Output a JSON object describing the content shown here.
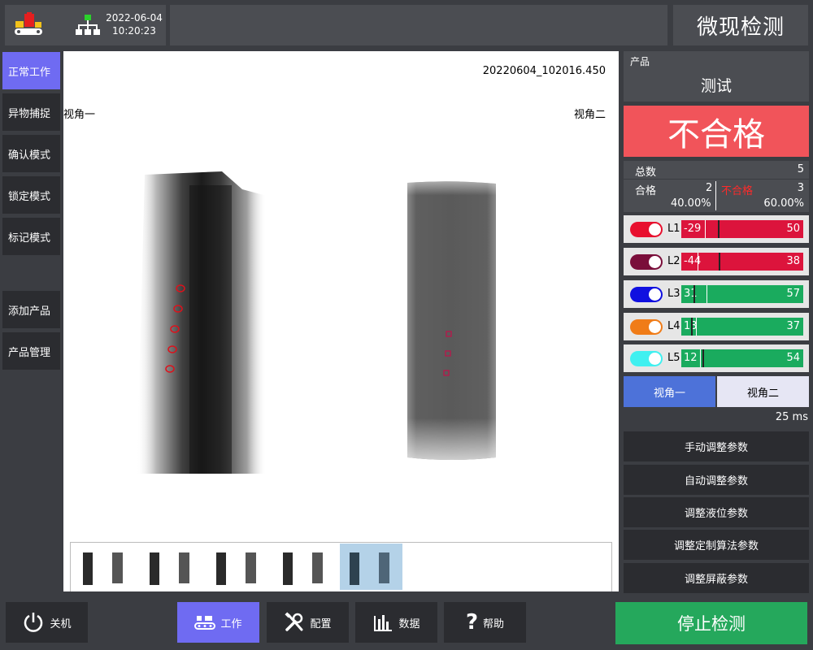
{
  "header": {
    "date": "2022-06-04",
    "time": "10:20:23",
    "app_title": "微现检测"
  },
  "sidebar": {
    "items": [
      {
        "label": "正常工作"
      },
      {
        "label": "异物捕捉"
      },
      {
        "label": "确认模式"
      },
      {
        "label": "锁定模式"
      },
      {
        "label": "标记模式"
      },
      {
        "label": "添加产品"
      },
      {
        "label": "产品管理"
      }
    ]
  },
  "viewer": {
    "timestamp": "20220604_102016.450",
    "view1_label": "视角一",
    "view2_label": "视角二",
    "thumbnail_count": 5,
    "selected_thumbnail": 5
  },
  "product": {
    "label": "产品",
    "name": "测试"
  },
  "result": {
    "text": "不合格",
    "color": "#f1545a"
  },
  "stats": {
    "total_label": "总数",
    "total": "5",
    "pass_label": "合格",
    "pass_count": "2",
    "pass_pct": "40.00%",
    "fail_label": "不合格",
    "fail_count": "3",
    "fail_pct": "60.00%"
  },
  "levels": [
    {
      "name": "L1",
      "low": "-29",
      "high": "50",
      "toggle_color": "#e8102e",
      "bar_color": "#dc143c"
    },
    {
      "name": "L2",
      "low": "-44",
      "high": "38",
      "toggle_color": "#7a0e3a",
      "bar_color": "#dc143c"
    },
    {
      "name": "L3",
      "low": "31",
      "high": "57",
      "toggle_color": "#1010e0",
      "bar_color": "#1aab5e"
    },
    {
      "name": "L4",
      "low": "13",
      "high": "37",
      "toggle_color": "#f07c18",
      "bar_color": "#1aab5e"
    },
    {
      "name": "L5",
      "low": "12",
      "high": "54",
      "toggle_color": "#40f0f0",
      "bar_color": "#1aab5e"
    }
  ],
  "view_tabs": {
    "tab1": "视角一",
    "tab2": "视角二",
    "active": "tab1"
  },
  "latency": "25 ms",
  "adjust_buttons": [
    {
      "label": "手动调整参数"
    },
    {
      "label": "自动调整参数"
    },
    {
      "label": "调整液位参数"
    },
    {
      "label": "调整定制算法参数"
    },
    {
      "label": "调整屏蔽参数"
    }
  ],
  "bottom": {
    "power": "关机",
    "work": "工作",
    "config": "配置",
    "data": "数据",
    "help": "帮助",
    "stop": "停止检测"
  },
  "colors": {
    "active_nav": "#6f6bf2",
    "stop_button": "#25a85c",
    "fail_text": "#ff2a2a"
  }
}
